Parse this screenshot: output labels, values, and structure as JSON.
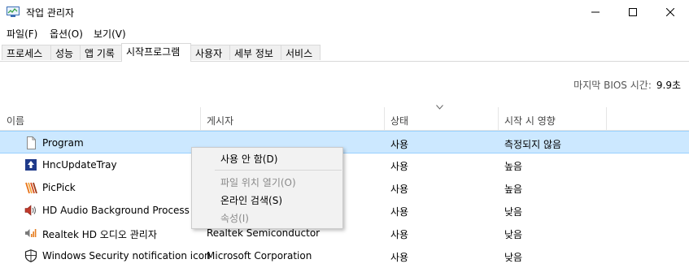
{
  "window": {
    "title": "작업 관리자"
  },
  "menu": [
    "파일(F)",
    "옵션(O)",
    "보기(V)"
  ],
  "tabs": [
    {
      "label": "프로세스",
      "active": false
    },
    {
      "label": "성능",
      "active": false
    },
    {
      "label": "앱 기록",
      "active": false
    },
    {
      "label": "시작프로그램",
      "active": true
    },
    {
      "label": "사용자",
      "active": false
    },
    {
      "label": "세부 정보",
      "active": false
    },
    {
      "label": "서비스",
      "active": false
    }
  ],
  "bios": {
    "label": "마지막 BIOS 시간:",
    "value": "9.9초"
  },
  "columns": {
    "name": "이름",
    "publisher": "게시자",
    "status": "상태",
    "impact": "시작 시 영향"
  },
  "rows": [
    {
      "icon": "blank-file-icon",
      "name": "Program",
      "publisher": "",
      "status": "사용",
      "impact": "측정되지 않음",
      "selected": true
    },
    {
      "icon": "hnc-update-icon",
      "name": "HncUpdateTray",
      "publisher": "",
      "status": "사용",
      "impact": "높음",
      "selected": false
    },
    {
      "icon": "picpick-icon",
      "name": "PicPick",
      "publisher": "",
      "status": "사용",
      "impact": "높음",
      "selected": false
    },
    {
      "icon": "speaker-icon",
      "name": "HD Audio Background Process",
      "publisher": "",
      "status": "사용",
      "impact": "낮음",
      "selected": false
    },
    {
      "icon": "realtek-audio-icon",
      "name": "Realtek HD 오디오 관리자",
      "publisher": "Realtek Semiconductor",
      "status": "사용",
      "impact": "낮음",
      "selected": false
    },
    {
      "icon": "windows-security-shield-icon",
      "name": "Windows Security notification icon",
      "publisher": "Microsoft Corporation",
      "status": "사용",
      "impact": "낮음",
      "selected": false
    }
  ],
  "context_menu": [
    {
      "label": "사용 안 함(D)",
      "enabled": true
    },
    {
      "label": "파일 위치 열기(O)",
      "enabled": false
    },
    {
      "label": "온라인 검색(S)",
      "enabled": true
    },
    {
      "label": "속성(I)",
      "enabled": false
    }
  ],
  "colors": {
    "selection": "#cce8ff",
    "selection_border": "#99d1ff",
    "hnc_blue": "#1f3a8a",
    "picpick_orange": "#e8731a"
  }
}
